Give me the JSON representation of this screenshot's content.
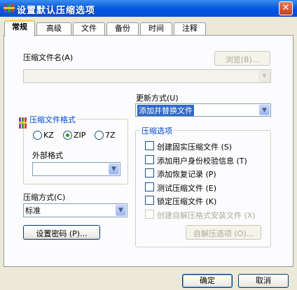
{
  "window": {
    "title": "设置默认压缩选项",
    "close_glyph": "✕"
  },
  "tabs": [
    {
      "label": "常规",
      "active": true
    },
    {
      "label": "高级"
    },
    {
      "label": "文件"
    },
    {
      "label": "备份"
    },
    {
      "label": "时间"
    },
    {
      "label": "注释"
    }
  ],
  "archive_name": {
    "label": "压缩文件名(A)",
    "value": "",
    "browse_label": "浏览(B)..."
  },
  "update_mode": {
    "label": "更新方式(U)",
    "value": "添加并替换文件"
  },
  "archive_format": {
    "title": "压缩文件格式",
    "options": [
      {
        "label": "KZ",
        "selected": false
      },
      {
        "label": "ZIP",
        "selected": true
      },
      {
        "label": "7Z",
        "selected": false
      }
    ],
    "external_label": "外部格式",
    "external_value": ""
  },
  "compression_options": {
    "title": "压缩选项",
    "items": [
      {
        "label": "创建固实压缩文件 (S)",
        "checked": false,
        "enabled": true
      },
      {
        "label": "添加用户身份校验信息 (T)",
        "checked": false,
        "enabled": true
      },
      {
        "label": "添加恢复记录 (P)",
        "checked": false,
        "enabled": true
      },
      {
        "label": "测试压缩文件 (E)",
        "checked": false,
        "enabled": true
      },
      {
        "label": "锁定压缩文件 (K)",
        "checked": false,
        "enabled": true
      },
      {
        "label": "创建自解压格式安装文件 (X)",
        "checked": false,
        "enabled": false
      }
    ],
    "sfx_button": "自解压选项 (O)..."
  },
  "compression_method": {
    "label": "压缩方式(C)",
    "value": "标准"
  },
  "password_button": "设置密码 (P)...",
  "footer": {
    "ok": "确定",
    "cancel": "取消"
  },
  "colors": {
    "titlebar": "#0054e3",
    "group_title": "#0046d5",
    "selection": "#316ac5",
    "tab_accent": "#ffc83c"
  }
}
